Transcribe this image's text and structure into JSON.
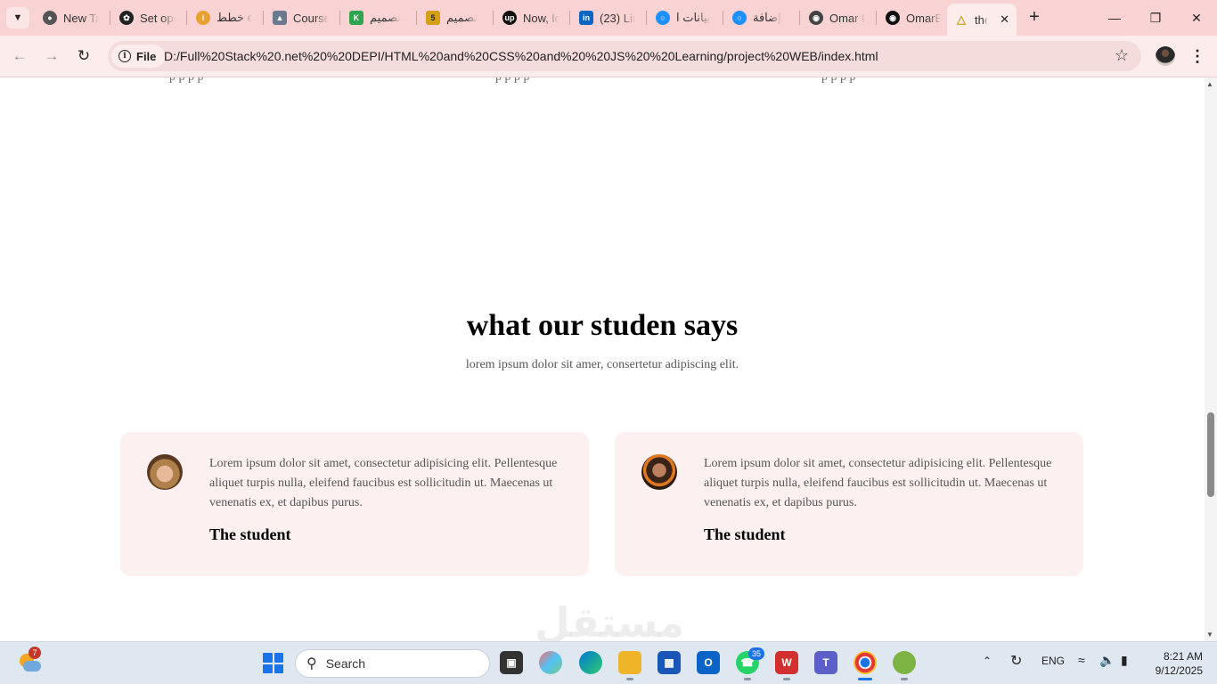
{
  "browser": {
    "tabs": [
      {
        "title": "New Ta",
        "icon": "chrome-icon",
        "color": "#555555"
      },
      {
        "title": "Set ope",
        "icon": "openai-icon",
        "color": "#222222"
      },
      {
        "title": "خطط e",
        "icon": "info-round-icon",
        "color": "#e8a030"
      },
      {
        "title": "Course",
        "icon": "course-icon",
        "color": "#6b7a90"
      },
      {
        "title": "تصميم",
        "icon": "k-icon",
        "color": "#2ea44f"
      },
      {
        "title": "تصميم",
        "icon": "five-icon",
        "color": "#d4a017"
      },
      {
        "title": "Now, le",
        "icon": "upwork-icon",
        "color": "#111111"
      },
      {
        "title": "(23) Lin",
        "icon": "linkedin-icon",
        "color": "#0a66c2"
      },
      {
        "title": "بيانات ا",
        "icon": "circle-icon",
        "color": "#1e90ff"
      },
      {
        "title": "إضافة",
        "icon": "circle-icon",
        "color": "#1e90ff"
      },
      {
        "title": "Omar E",
        "icon": "globe-icon",
        "color": "#444444"
      },
      {
        "title": "OmarEl",
        "icon": "github-icon",
        "color": "#111111"
      },
      {
        "title": "the",
        "icon": "page-icon",
        "color": "#c9a227",
        "active": true
      }
    ],
    "address_scheme": "File",
    "url": "D:/Full%20Stack%20.net%20%20DEPI/HTML%20and%20CSS%20and%20%20JS%20%20Learning/project%20WEB/index.html"
  },
  "page": {
    "cut_off_text": [
      "p p p p",
      "p p p p",
      "p p p p"
    ],
    "section_title": "what our studen says",
    "section_subtitle": "lorem ipsum dolor sit amer, consertetur adipiscing elit.",
    "testimonials": [
      {
        "text": "Lorem ipsum dolor sit amet, consectetur adipisicing elit. Pellentesque aliquet turpis nulla, eleifend faucibus est sollicitudin ut. Maecenas ut venenatis ex, et dapibus purus.",
        "name": "The student",
        "avatar": "female-avatar"
      },
      {
        "text": "Lorem ipsum dolor sit amet, consectetur adipisicing elit. Pellentesque aliquet turpis nulla, eleifend faucibus est sollicitudin ut. Maecenas ut venenatis ex, et dapibus purus.",
        "name": "The student",
        "avatar": "male-avatar"
      }
    ],
    "watermark": "مستقل"
  },
  "taskbar": {
    "weather_badge": "7",
    "search_placeholder": "Search",
    "whatsapp_badge": "35",
    "language": "ENG",
    "time": "8:21 AM",
    "date": "9/12/2025"
  }
}
